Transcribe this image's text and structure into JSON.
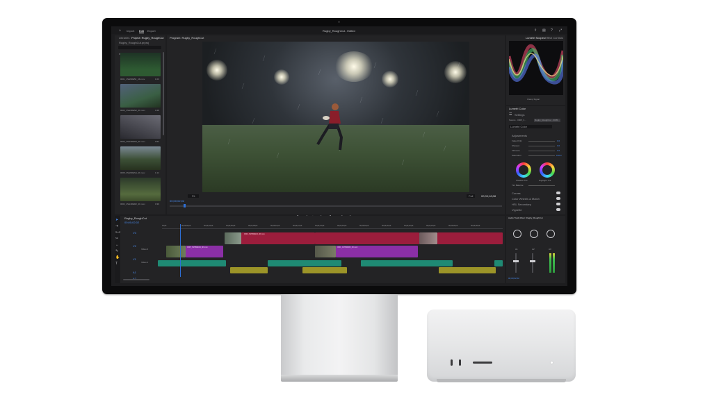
{
  "app": {
    "window_title": "Rugby_RoughCut - Edited",
    "nav_tabs": [
      {
        "label": "Import"
      },
      {
        "label": "Edit"
      },
      {
        "label": "Export"
      }
    ]
  },
  "project_panel": {
    "tabs": [
      {
        "label": "Libraries"
      },
      {
        "label": "Project: Rugby_RoughCut"
      }
    ],
    "path": "Rugby_RoughCut.prproj",
    "clips": [
      {
        "name": "0001_1SH6RE52_4K.mov",
        "duration": "1:03",
        "color": "#2e5a32"
      },
      {
        "name": "0003_3SH3REN2_4K.mov",
        "duration": "0:48",
        "color": "#3a5f44"
      },
      {
        "name": "0003_3SH3REN3_4K.mov",
        "duration": "0:52",
        "color": "#4a4a52"
      },
      {
        "name": "0005_3SH6RES4_4K.mov",
        "duration": "1:14",
        "color": "#3c4f36"
      },
      {
        "name": "0002_2SH4RER2_4K.mov",
        "duration": "0:39",
        "color": "#556b3e"
      }
    ]
  },
  "program_monitor": {
    "tab": "Program: Rugby_RoughCut",
    "timecode_left": "00;00;02;02",
    "fit": "Fit",
    "quality": "Full",
    "timecode_right": "00;00;18;08"
  },
  "right_panels": {
    "scope_tabs": [
      {
        "label": "Lumetri Scopes"
      },
      {
        "label": "Effect Controls"
      }
    ],
    "scope_readout": "Clamp Signal",
    "lumetri": {
      "title": "Lumetri Color",
      "settings": "Settings",
      "source": "Source · 0005_3...",
      "clip": "Rugby_RoughCut · 0005...",
      "preset": "Lumetri Color",
      "section": "Adjustments",
      "sliders": [
        {
          "label": "Faded Film",
          "value": "0.0"
        },
        {
          "label": "Sharpen",
          "value": "0.0"
        },
        {
          "label": "Vibrance",
          "value": "0.0"
        },
        {
          "label": "Saturation",
          "value": "100.0"
        }
      ],
      "wheel_labels": [
        {
          "label": "Shadow Tint"
        },
        {
          "label": "Highlight Tint"
        }
      ],
      "tint_balance": "Tint Balance",
      "sections": [
        {
          "label": "Curves"
        },
        {
          "label": "Color Wheels & Match"
        },
        {
          "label": "HSL Secondary"
        },
        {
          "label": "Vignette"
        }
      ]
    },
    "mixer": {
      "title": "Audio Track Mixer: Rugby_RoughCut",
      "channels": [
        {
          "label": "A1"
        },
        {
          "label": "A2"
        },
        {
          "label": "A3"
        }
      ],
      "timecode": "00;00;02;02"
    }
  },
  "timeline": {
    "tab": "Rugby_RoughCut",
    "timecode": "00;00;02;02",
    "ruler": [
      "00;00",
      "00;00;02;00",
      "00;00;04;00",
      "00;00;06;00",
      "00;00;08;00",
      "00;00;10;00",
      "00;00;12;00",
      "00;00;14;00",
      "00;00;16;00",
      "00;00;18;00",
      "00;00;20;00",
      "00;00;22;00",
      "00;00;24;00",
      "00;00;26;00",
      "00;00;28;00"
    ],
    "tracks": [
      {
        "name": "V3"
      },
      {
        "name": "V2"
      },
      {
        "name": "V1"
      },
      {
        "name": "A1"
      },
      {
        "name": "A2"
      }
    ],
    "track_labels": [
      {
        "label": "Video 2"
      },
      {
        "label": "Video 1"
      }
    ],
    "clip_names": [
      {
        "name": "0003_3SH3REN2_4K.mov"
      },
      {
        "name": "0005_3SH6RES4_4K.mov"
      },
      {
        "name": "0001_1SH6RE52_4K.mov"
      }
    ]
  },
  "colors": {
    "clip_pink": "#9b1d3c",
    "clip_purple": "#8b2fa6",
    "clip_teal": "#1f8a74",
    "clip_yellow": "#9c9428",
    "accent_blue": "#2d6fd6"
  }
}
